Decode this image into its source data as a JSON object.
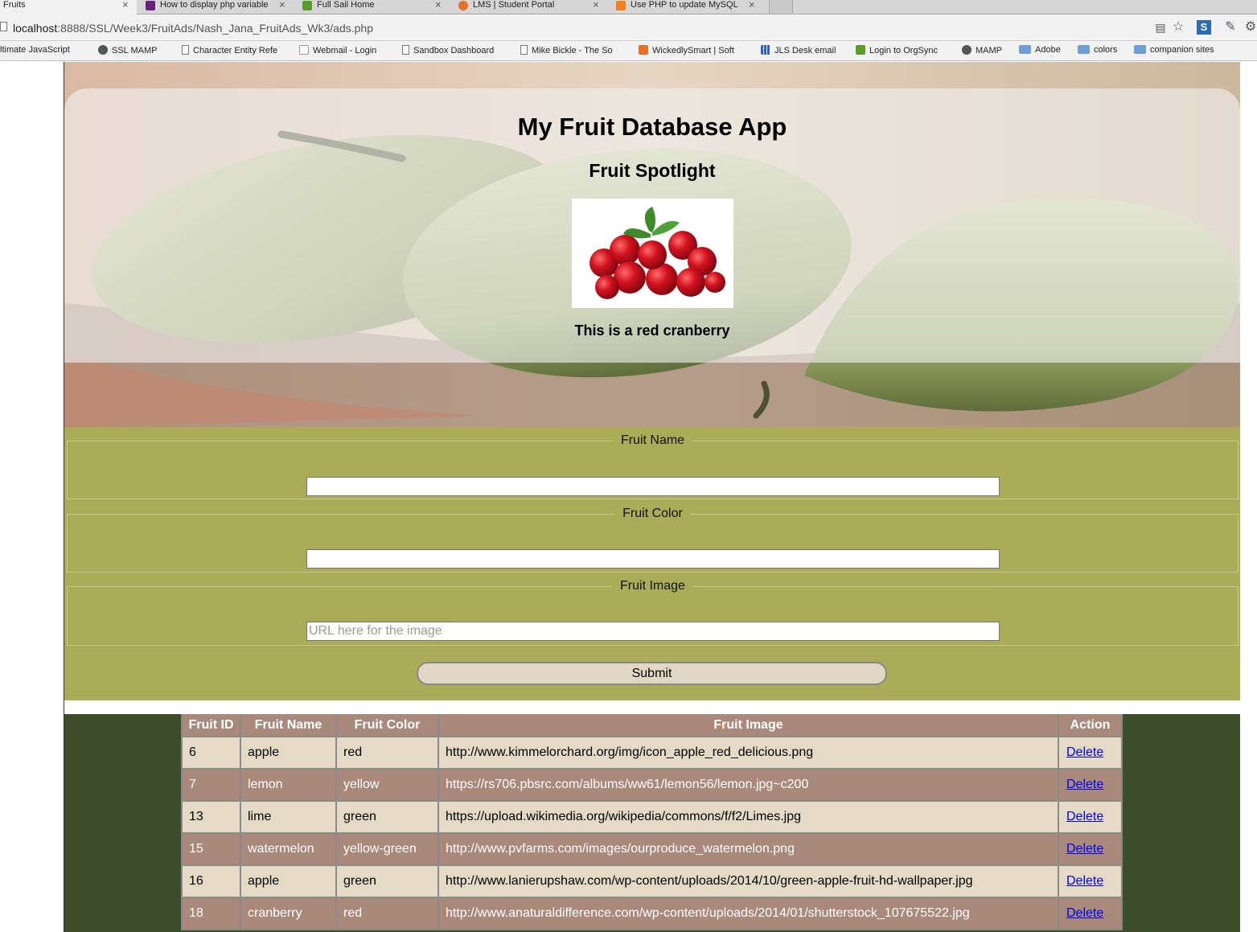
{
  "browser": {
    "tabs": [
      {
        "title": "Fruits",
        "active": true
      },
      {
        "title": "How to display php variable",
        "active": false
      },
      {
        "title": "Full Sail Home",
        "active": false
      },
      {
        "title": "LMS | Student Portal",
        "active": false
      },
      {
        "title": "Use PHP to update MySQL",
        "active": false
      }
    ],
    "url": {
      "host": "localhost",
      "rest": ":8888/SSL/Week3/FruitAds/Nash_Jana_FruitAds_Wk3/ads.php"
    },
    "bookmarks": [
      {
        "label": "ltimate JavaScript",
        "icon": "none"
      },
      {
        "label": "SSL MAMP",
        "icon": "mamp-icon"
      },
      {
        "label": "Character Entity Refe",
        "icon": "doc-icon"
      },
      {
        "label": "Webmail - Login",
        "icon": "mail-icon"
      },
      {
        "label": "Sandbox Dashboard",
        "icon": "doc-icon"
      },
      {
        "label": "Mike Bickle - The So",
        "icon": "doc-icon"
      },
      {
        "label": "WickedlySmart | Soft",
        "icon": "ws-icon"
      },
      {
        "label": "JLS Desk email",
        "icon": "grid-icon"
      },
      {
        "label": "Login to OrgSync",
        "icon": "orgsync-icon"
      },
      {
        "label": "MAMP",
        "icon": "mamp-icon"
      },
      {
        "label": "Adobe",
        "icon": "folder-icon"
      },
      {
        "label": "colors",
        "icon": "folder-icon"
      },
      {
        "label": "companion sites",
        "icon": "folder-icon"
      }
    ]
  },
  "hero": {
    "title": "My Fruit Database App",
    "spotlight_title": "Fruit Spotlight",
    "spotlight_caption": "This is a red cranberry"
  },
  "form": {
    "name_legend": "Fruit Name",
    "name_value": "",
    "color_legend": "Fruit Color",
    "color_value": "",
    "image_legend": "Fruit Image",
    "image_value": "",
    "image_placeholder": "URL here for the image",
    "submit_label": "Submit"
  },
  "table": {
    "headers": [
      "Fruit ID",
      "Fruit Name",
      "Fruit Color",
      "Fruit Image",
      "Action"
    ],
    "rows": [
      {
        "id": "6",
        "name": "apple",
        "color": "red",
        "image": "http://www.kimmelorchard.org/img/icon_apple_red_delicious.png",
        "action": "Delete"
      },
      {
        "id": "7",
        "name": "lemon",
        "color": "yellow",
        "image": "https://rs706.pbsrc.com/albums/ww61/lemon56/lemon.jpg~c200",
        "action": "Delete"
      },
      {
        "id": "13",
        "name": "lime",
        "color": "green",
        "image": "https://upload.wikimedia.org/wikipedia/commons/f/f2/Limes.jpg",
        "action": "Delete"
      },
      {
        "id": "15",
        "name": "watermelon",
        "color": "yellow-green",
        "image": "http://www.pvfarms.com/images/ourproduce_watermelon.png",
        "action": "Delete"
      },
      {
        "id": "16",
        "name": "apple",
        "color": "green",
        "image": "http://www.lanierupshaw.com/wp-content/uploads/2014/10/green-apple-fruit-hd-wallpaper.jpg",
        "action": "Delete"
      },
      {
        "id": "18",
        "name": "cranberry",
        "color": "red",
        "image": "http://www.anaturaldifference.com/wp-content/uploads/2014/01/shutterstock_107675522.jpg",
        "action": "Delete"
      }
    ]
  },
  "colors": {
    "form_bg": "#aaac57",
    "table_area_bg": "#3d4c2a",
    "row_light": "#e4dac5",
    "row_dark": "#a8897a",
    "link": "#0000ee"
  }
}
